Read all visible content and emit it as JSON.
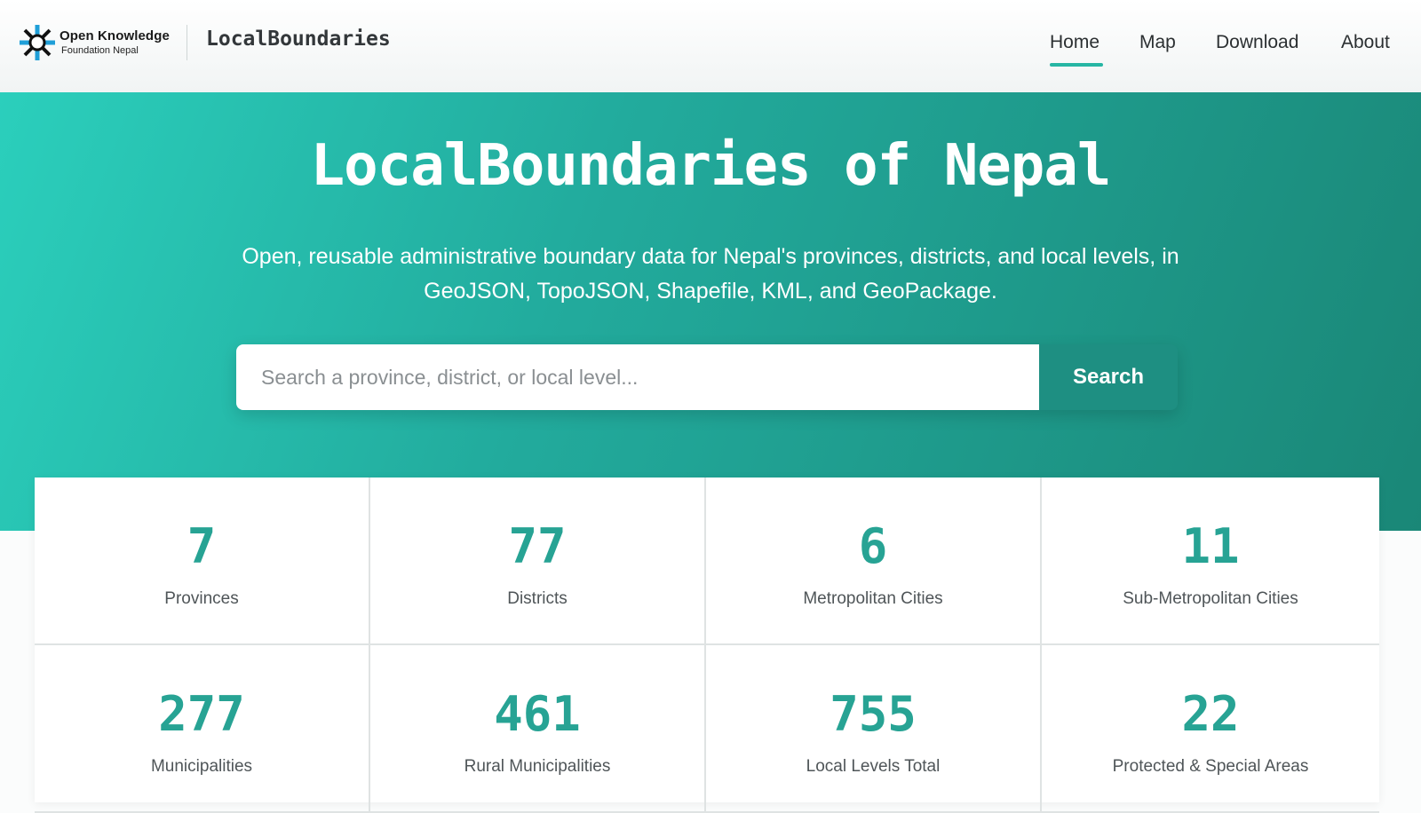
{
  "header": {
    "org_name": "Open Knowledge",
    "org_sub": "Foundation Nepal",
    "site_name": "LocalBoundaries",
    "nav": [
      {
        "label": "Home",
        "active": true
      },
      {
        "label": "Map"
      },
      {
        "label": "Download"
      },
      {
        "label": "About"
      }
    ]
  },
  "hero": {
    "title": "LocalBoundaries of Nepal",
    "description": "Open, reusable administrative boundary data for Nepal's provinces, districts, and local levels, in GeoJSON, TopoJSON, Shapefile, KML, and GeoPackage.",
    "search_placeholder": "Search a province, district, or local level...",
    "search_button": "Search"
  },
  "stats": [
    {
      "value": "7",
      "label": "Provinces"
    },
    {
      "value": "77",
      "label": "Districts"
    },
    {
      "value": "6",
      "label": "Metropolitan Cities"
    },
    {
      "value": "11",
      "label": "Sub-Metropolitan Cities"
    },
    {
      "value": "277",
      "label": "Municipalities"
    },
    {
      "value": "461",
      "label": "Rural Municipalities"
    },
    {
      "value": "755",
      "label": "Local Levels Total"
    },
    {
      "value": "22",
      "label": "Protected & Special Areas"
    }
  ],
  "colors": {
    "accent": "#26b6a4",
    "hero_start": "#2bcfbc",
    "hero_end": "#1a8777",
    "stat_number": "#27a394",
    "search_button": "#1e8f82",
    "logo_blue": "#1f9fd8"
  },
  "icons": {
    "logo": "okfn-knot-logo-icon"
  }
}
